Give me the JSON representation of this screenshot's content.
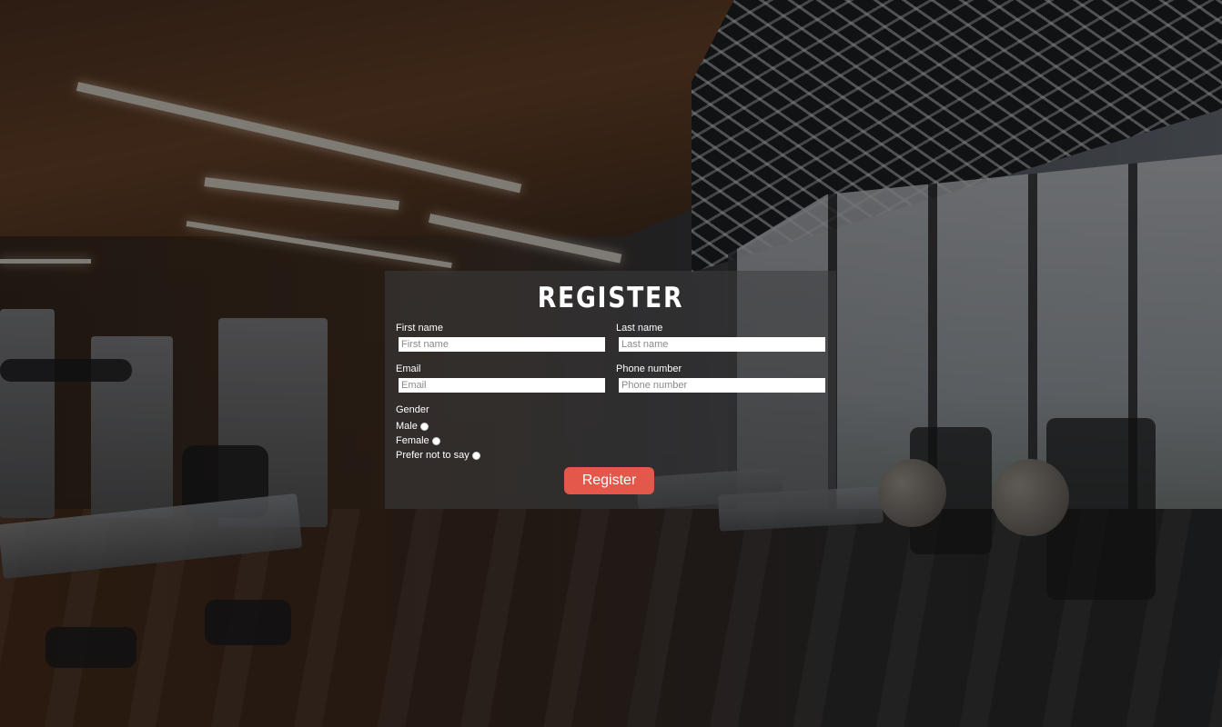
{
  "form": {
    "title": "REGISTER",
    "first_name": {
      "label": "First name",
      "placeholder": "First name",
      "value": ""
    },
    "last_name": {
      "label": "Last name",
      "placeholder": "Last name",
      "value": ""
    },
    "email": {
      "label": "Email",
      "placeholder": "Email",
      "value": ""
    },
    "phone": {
      "label": "Phone number",
      "placeholder": "Phone number",
      "value": ""
    },
    "gender": {
      "label": "Gender",
      "options": [
        "Male",
        "Female",
        "Prefer not to say"
      ]
    },
    "submit_label": "Register"
  },
  "colors": {
    "accent": "#e4574b",
    "text": "#ffffff",
    "panel": "rgba(60,60,62,0.55)"
  },
  "background": {
    "icon": "gym-photo-background"
  }
}
